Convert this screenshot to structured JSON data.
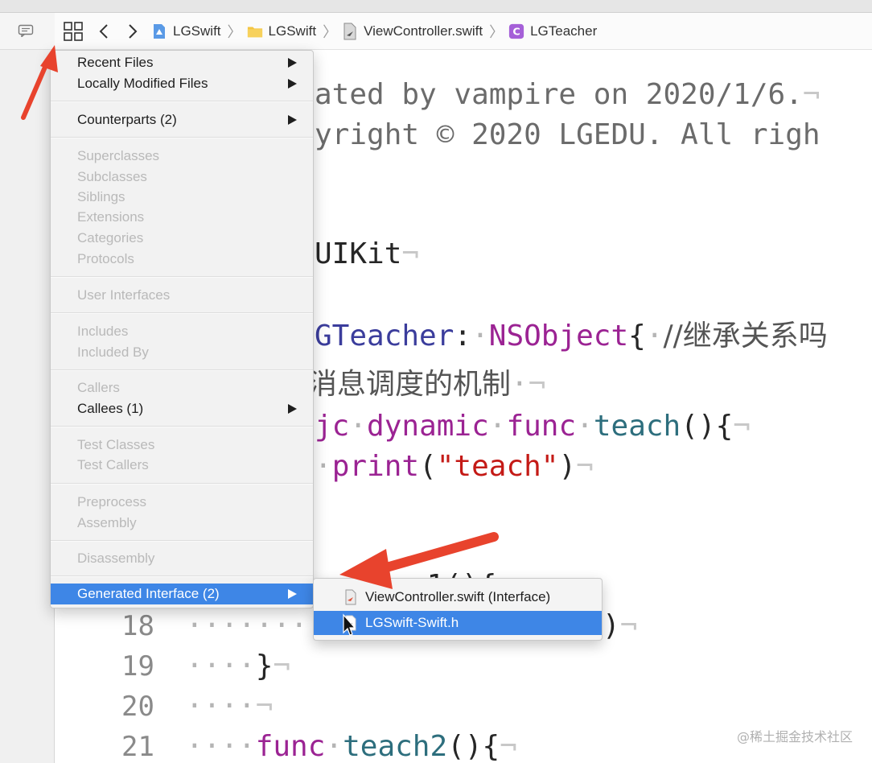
{
  "toolbar": {
    "breadcrumbs": [
      {
        "label": "LGSwift",
        "icon": "project-icon"
      },
      {
        "label": "LGSwift",
        "icon": "folder-icon"
      },
      {
        "label": "ViewController.swift",
        "icon": "swift-file-icon"
      },
      {
        "label": "LGTeacher",
        "icon": "class-icon"
      }
    ]
  },
  "editor": {
    "header_comment_1": "ated by vampire on 2020/1/6.",
    "header_comment_2": "yright © 2020 LGEDU. All righ",
    "import_text": "UIKit",
    "class_name": "GTeacher",
    "class_colon": ":",
    "superclass": "NSObject",
    "class_brace": "{",
    "class_comment": "//继承关系吗",
    "cn_comment": "消息调度的机制",
    "objc_kw": "jc",
    "dynamic_kw": "dynamic",
    "func_kw": "func",
    "method_name": "teach",
    "method_tail": "(){",
    "print_name": "print",
    "print_open": "(",
    "print_string": "\"teach\"",
    "print_close": ")",
    "line16_tail": "c1(){",
    "line18_tail": ")",
    "line19_brace": "}",
    "line21_func": "func",
    "line21_name": "teach2",
    "line21_tail": "(){",
    "line_numbers": [
      "18",
      "19",
      "20",
      "21"
    ]
  },
  "menu": {
    "recent_files": "Recent Files",
    "locally_modified": "Locally Modified Files",
    "counterparts": "Counterparts (2)",
    "superclasses": "Superclasses",
    "subclasses": "Subclasses",
    "siblings": "Siblings",
    "extensions": "Extensions",
    "categories": "Categories",
    "protocols": "Protocols",
    "user_interfaces": "User Interfaces",
    "includes": "Includes",
    "included_by": "Included By",
    "callers": "Callers",
    "callees": "Callees (1)",
    "test_classes": "Test Classes",
    "test_callers": "Test Callers",
    "preprocess": "Preprocess",
    "assembly": "Assembly",
    "disassembly": "Disassembly",
    "generated_interface": "Generated Interface (2)"
  },
  "submenu": {
    "item1": "ViewController.swift (Interface)",
    "item2": "LGSwift-Swift.h"
  },
  "watermark": "@稀土掘金技术社区",
  "colors": {
    "selection": "#3e86e6",
    "keyword": "#9b2393",
    "annotation_arrow": "#e8432d"
  }
}
